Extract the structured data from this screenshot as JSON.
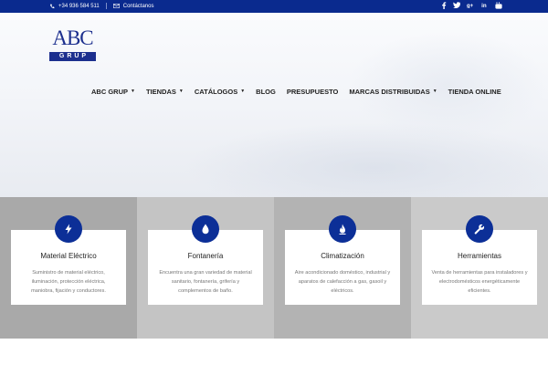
{
  "topbar": {
    "phone": "+34 936 584 511",
    "contact_label": "Contáctanos",
    "social": [
      {
        "name": "facebook-icon",
        "glyph": "f"
      },
      {
        "name": "twitter-icon",
        "glyph": "t"
      },
      {
        "name": "google-plus-icon",
        "glyph": "g+"
      },
      {
        "name": "linkedin-icon",
        "glyph": "in"
      },
      {
        "name": "youtube-icon",
        "glyph": "yt"
      }
    ]
  },
  "logo": {
    "line1": "ABC",
    "line2": "GRUP"
  },
  "nav": {
    "items": [
      {
        "label": "ABC GRUP",
        "dropdown": true
      },
      {
        "label": "TIENDAS",
        "dropdown": true
      },
      {
        "label": "CATÁLOGOS",
        "dropdown": true
      },
      {
        "label": "BLOG",
        "dropdown": false
      },
      {
        "label": "PRESUPUESTO",
        "dropdown": false
      },
      {
        "label": "MARCAS DISTRIBUIDAS",
        "dropdown": true
      },
      {
        "label": "TIENDA ONLINE",
        "dropdown": false
      }
    ],
    "caret": "▼"
  },
  "features": [
    {
      "title": "Material Eléctrico",
      "text": "Suministro de material eléctrico, iluminación, protección eléctrica, maniobra, fijación y conductores.",
      "icon": "bolt-icon",
      "bg": "#a9a9a9"
    },
    {
      "title": "Fontanería",
      "text": "Encuentra una gran variedad de material sanitario, fontanería, grifería y complementos de baño.",
      "icon": "water-drop-icon",
      "bg": "#c4c4c4"
    },
    {
      "title": "Climatización",
      "text": "Aire acondicionado doméstico, industrial y aparatos de calefacción a gas, gasoil y eléctricos.",
      "icon": "flame-icon",
      "bg": "#b3b3b3"
    },
    {
      "title": "Herramientas",
      "text": "Venta de herramientas para instaladores y electrodomésticos energéticamente eficientes.",
      "icon": "wrench-icon",
      "bg": "#cacaca"
    }
  ],
  "colors": {
    "brand": "#0a2a8e",
    "icon_circle": "#0c2f97"
  }
}
